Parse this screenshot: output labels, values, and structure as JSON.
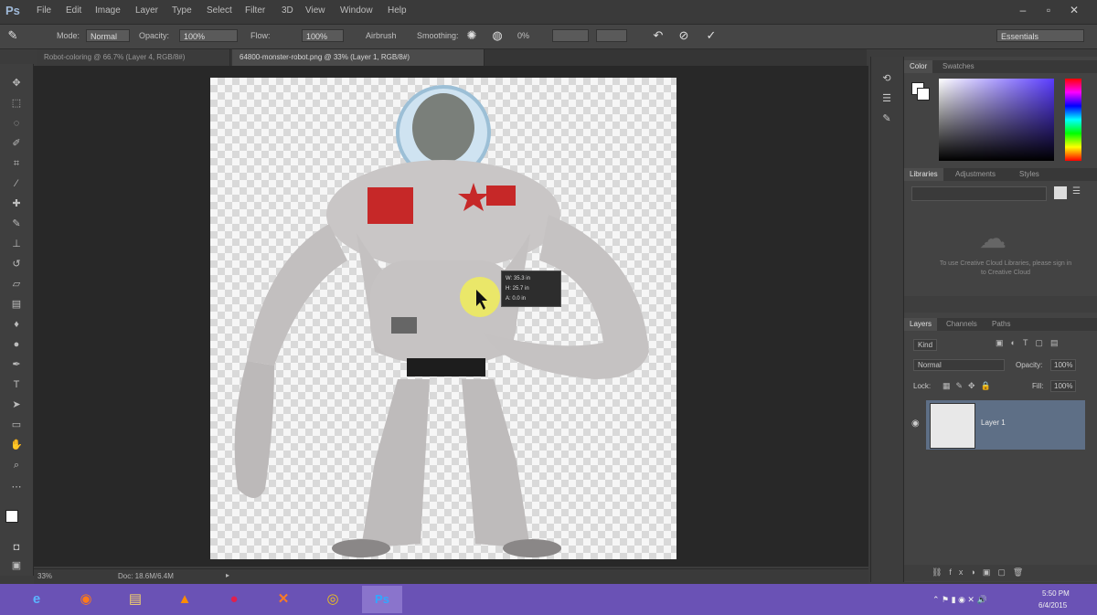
{
  "app": {
    "logo": "Ps"
  },
  "menu": [
    "File",
    "Edit",
    "Image",
    "Layer",
    "Type",
    "Select",
    "Filter",
    "3D",
    "View",
    "Window",
    "Help"
  ],
  "options": {
    "mode_label": "Mode:",
    "mode_value": "Normal",
    "opacity_label": "Opacity:",
    "opacity_value": "100%",
    "flow_label": "Flow:",
    "flow_value": "100%",
    "airbrush_label": "Airbrush",
    "smoothing_label": "Smoothing:",
    "smoothing_value": "0%",
    "workspace_value": "Essentials"
  },
  "doc_tabs": [
    "Robot-coloring @ 66.7% (Layer 4, RGB/8#)",
    "64800-monster-robot.png @ 33% (Layer 1, RGB/8#)"
  ],
  "readout": {
    "w": "W: 35.3 in",
    "h": "H: 25.7 in",
    "a": "A: 0.0 in"
  },
  "status": {
    "zoom": "33%",
    "doc": "Doc: 18.6M/6.4M"
  },
  "panels": {
    "color_tabs": [
      "Color",
      "Swatches"
    ],
    "library_tabs": [
      "Libraries",
      "Adjustments",
      "Styles"
    ],
    "library_message": "To use Creative Cloud Libraries, please sign in to Creative Cloud",
    "layers_tabs": [
      "Layers",
      "Channels",
      "Paths"
    ],
    "kind_label": "Kind",
    "blend_mode": "Normal",
    "opacity_label": "Opacity:",
    "opacity_value": "100%",
    "lock_label": "Lock:",
    "fill_label": "Fill:",
    "fill_value": "100%",
    "layer_name": "Layer 1"
  },
  "taskbar": {
    "apps": [
      {
        "icon": "ie-icon",
        "glyph": "e"
      },
      {
        "icon": "firefox-icon",
        "glyph": "◉"
      },
      {
        "icon": "file-explorer-icon",
        "glyph": "▤"
      },
      {
        "icon": "vlc-icon",
        "glyph": "▲"
      },
      {
        "icon": "app-red-icon",
        "glyph": "●"
      },
      {
        "icon": "xampp-icon",
        "glyph": "✕"
      },
      {
        "icon": "chrome-icon",
        "glyph": "◎"
      },
      {
        "icon": "photoshop-icon",
        "glyph": "Ps"
      }
    ],
    "time": "5:50 PM",
    "date": "6/4/2015"
  },
  "colors": {
    "accent": "#6a52b5",
    "panel": "#434343",
    "canvas_bg": "#282828",
    "robot_red": "#c62828"
  }
}
